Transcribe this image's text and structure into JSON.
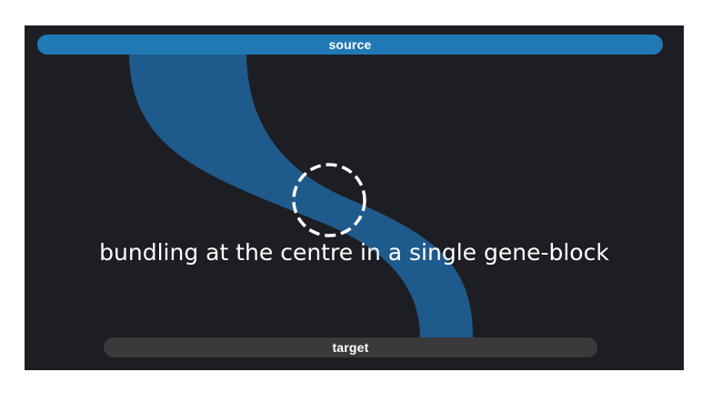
{
  "nodes": {
    "source": {
      "label": "source",
      "color": "#2079b4"
    },
    "target": {
      "label": "target",
      "color": "#3a3a3c"
    }
  },
  "ribbon": {
    "color": "#1f5a8c"
  },
  "highlight": {
    "stroke": "#ffffff",
    "style": "dashed"
  },
  "caption": "bundling at the centre in a single gene-block",
  "background": "#1d1e23"
}
